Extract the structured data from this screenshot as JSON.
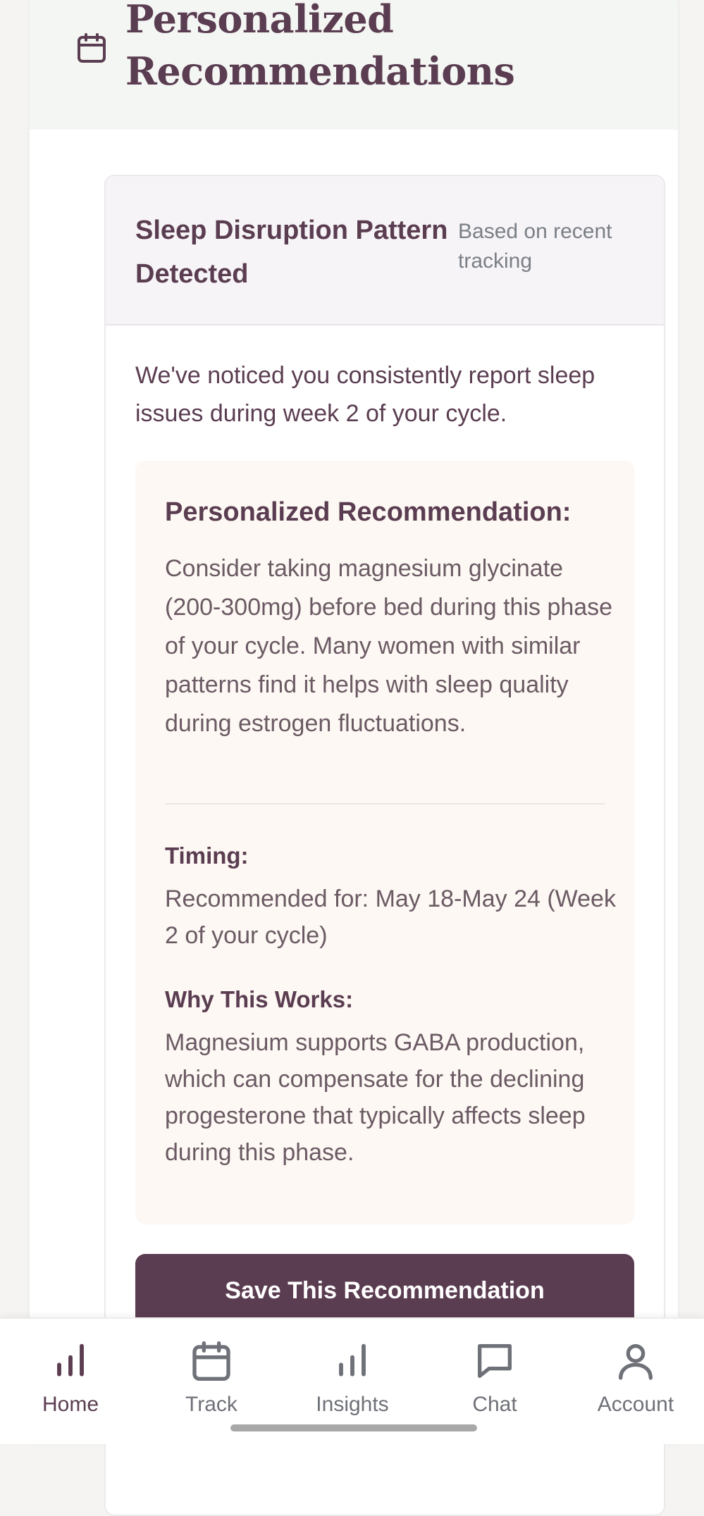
{
  "header": {
    "title": "Personalized Recommendations",
    "icon": "calendar-icon"
  },
  "card": {
    "title": "Sleep Disruption Pattern Detected",
    "meta": "Based on recent tracking",
    "intro": "We've noticed you consistently report sleep issues during week 2 of your cycle.",
    "recommendation": {
      "heading": "Personalized Recommendation:",
      "body": "Consider taking magnesium glycinate (200-300mg) before bed during this phase of your cycle. Many women with similar patterns find it helps with sleep quality during estrogen fluctuations.",
      "timing_label": "Timing:",
      "timing_text": "Recommended for: May 18-May 24 (Week 2 of your cycle)",
      "why_label": "Why This Works:",
      "why_text": "Magnesium supports GABA production, which can compensate for the declining progesterone that typically affects sleep during this phase."
    },
    "save_label": "Save This Recommendation"
  },
  "nav": {
    "items": [
      {
        "label": "Home",
        "icon": "bar-chart-icon",
        "active": true
      },
      {
        "label": "Track",
        "icon": "calendar-icon",
        "active": false
      },
      {
        "label": "Insights",
        "icon": "bar-chart-icon",
        "active": false
      },
      {
        "label": "Chat",
        "icon": "chat-bubble-icon",
        "active": false
      },
      {
        "label": "Account",
        "icon": "user-icon",
        "active": false
      }
    ]
  },
  "colors": {
    "primary": "#5b3d51",
    "header_bg": "#f4f6f3",
    "rec_bg": "#fdf8f3",
    "muted_text": "#7a7f87"
  }
}
